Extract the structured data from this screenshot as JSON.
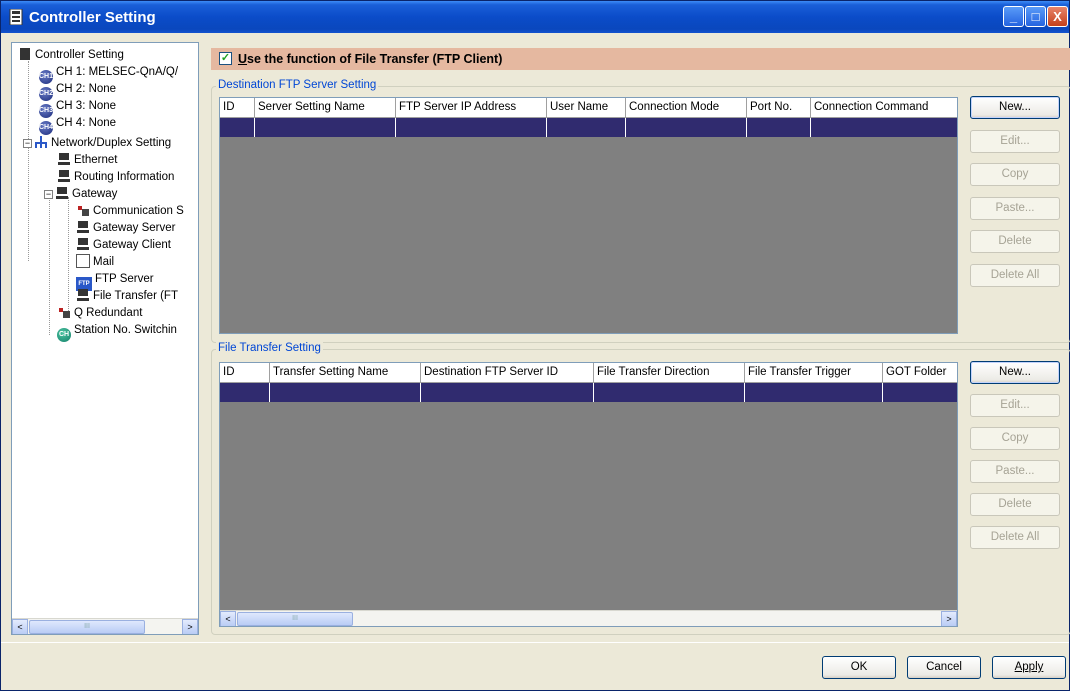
{
  "window": {
    "title": "Controller Setting",
    "controls": {
      "minimize": "_",
      "maximize": "□",
      "close": "X"
    }
  },
  "tree": {
    "items": [
      {
        "label": "Controller Setting",
        "icon": "controller-setting-icon"
      },
      {
        "label": "CH 1: MELSEC-QnA/Q/",
        "icon": "ch1-icon",
        "badge": "CH1"
      },
      {
        "label": "CH 2: None",
        "icon": "ch2-icon",
        "badge": "CH2"
      },
      {
        "label": "CH 3: None",
        "icon": "ch3-icon",
        "badge": "CH3"
      },
      {
        "label": "CH 4: None",
        "icon": "ch4-icon",
        "badge": "CH4"
      },
      {
        "label": "Network/Duplex Setting",
        "icon": "network-icon",
        "expander": "−"
      },
      {
        "label": "Ethernet",
        "icon": "ethernet-icon"
      },
      {
        "label": "Routing Information",
        "icon": "routing-icon"
      },
      {
        "label": "Gateway",
        "icon": "gateway-icon",
        "expander": "−"
      },
      {
        "label": "Communication S",
        "icon": "communication-icon"
      },
      {
        "label": "Gateway Server",
        "icon": "gateway-server-icon"
      },
      {
        "label": "Gateway Client",
        "icon": "gateway-client-icon"
      },
      {
        "label": "Mail",
        "icon": "mail-icon"
      },
      {
        "label": "FTP Server",
        "icon": "ftp-server-icon",
        "badge": "FTP"
      },
      {
        "label": "File Transfer (FT",
        "icon": "file-transfer-icon"
      },
      {
        "label": "Q Redundant",
        "icon": "q-redundant-icon"
      },
      {
        "label": "Station No. Switchin",
        "icon": "station-switching-icon",
        "badge": "CH"
      }
    ],
    "scroll_left": "<",
    "scroll_right": ">",
    "scroll_thumb": "III"
  },
  "ftp_client": {
    "checkbox_mark": "✓",
    "checked": true,
    "label_underline": "U",
    "label_rest": "se the function of File Transfer (FTP Client)"
  },
  "destination_group": {
    "title": "Destination FTP Server Setting",
    "columns": [
      "ID",
      "Server Setting Name",
      "FTP Server IP Address",
      "User Name",
      "Connection Mode",
      "Port No.",
      "Connection Command"
    ],
    "buttons": [
      {
        "label": "New...",
        "enabled": true
      },
      {
        "label": "Edit...",
        "enabled": false
      },
      {
        "label": "Copy",
        "enabled": false
      },
      {
        "label": "Paste...",
        "enabled": false
      },
      {
        "label": "Delete",
        "enabled": false
      },
      {
        "label": "Delete All",
        "enabled": false
      }
    ]
  },
  "transfer_group": {
    "title": "File Transfer Setting",
    "columns": [
      "ID",
      "Transfer Setting Name",
      "Destination FTP Server ID",
      "File Transfer Direction",
      "File Transfer Trigger",
      "GOT Folder"
    ],
    "scroll_left": "<",
    "scroll_right": ">",
    "scroll_thumb": "III",
    "buttons": [
      {
        "label": "New...",
        "enabled": true
      },
      {
        "label": "Edit...",
        "enabled": false
      },
      {
        "label": "Copy",
        "enabled": false
      },
      {
        "label": "Paste...",
        "enabled": false
      },
      {
        "label": "Delete",
        "enabled": false
      },
      {
        "label": "Delete All",
        "enabled": false
      }
    ]
  },
  "footer": {
    "ok": "OK",
    "cancel": "Cancel",
    "apply": "Apply"
  },
  "colors": {
    "selected_row": "#302b6f",
    "grid_background": "#808080",
    "checkbar_background": "#e5b8a0",
    "group_title": "#0046d5"
  }
}
